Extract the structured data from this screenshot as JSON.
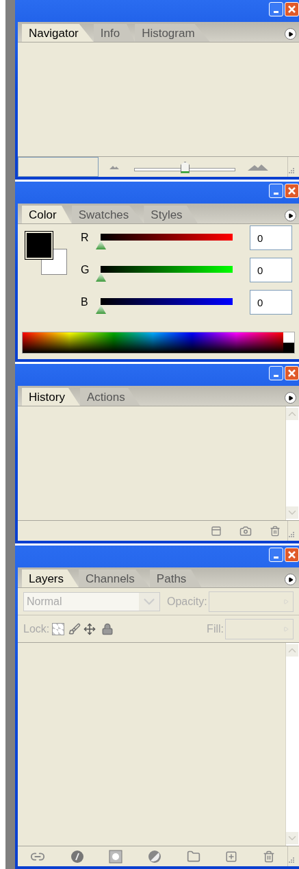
{
  "panels": [
    {
      "kind": "navigator",
      "tabs": [
        {
          "label": "Navigator",
          "selected": true
        },
        {
          "label": "Info",
          "selected": false
        },
        {
          "label": "Histogram",
          "selected": false
        }
      ],
      "zoom": {
        "level": 0.5
      }
    },
    {
      "kind": "color",
      "tabs": [
        {
          "label": "Color",
          "selected": true
        },
        {
          "label": "Swatches",
          "selected": false
        },
        {
          "label": "Styles",
          "selected": false
        }
      ],
      "channels": [
        {
          "name": "R",
          "level": 0,
          "value": "0"
        },
        {
          "name": "G",
          "level": 0,
          "value": "0"
        },
        {
          "name": "B",
          "level": 0,
          "value": "0"
        }
      ]
    },
    {
      "kind": "history",
      "tabs": [
        {
          "label": "History",
          "selected": true
        },
        {
          "label": "Actions",
          "selected": false
        }
      ]
    },
    {
      "kind": "layers",
      "tabs": [
        {
          "label": "Layers",
          "selected": true
        },
        {
          "label": "Channels",
          "selected": false
        },
        {
          "label": "Paths",
          "selected": false
        }
      ],
      "blend_mode": {
        "value": "Normal",
        "disabled": true
      },
      "opacity": {
        "label": "Opacity:",
        "disabled": true
      },
      "lock": {
        "label": "Lock:",
        "disabled": true
      },
      "fill": {
        "label": "Fill:",
        "disabled": true
      }
    }
  ]
}
